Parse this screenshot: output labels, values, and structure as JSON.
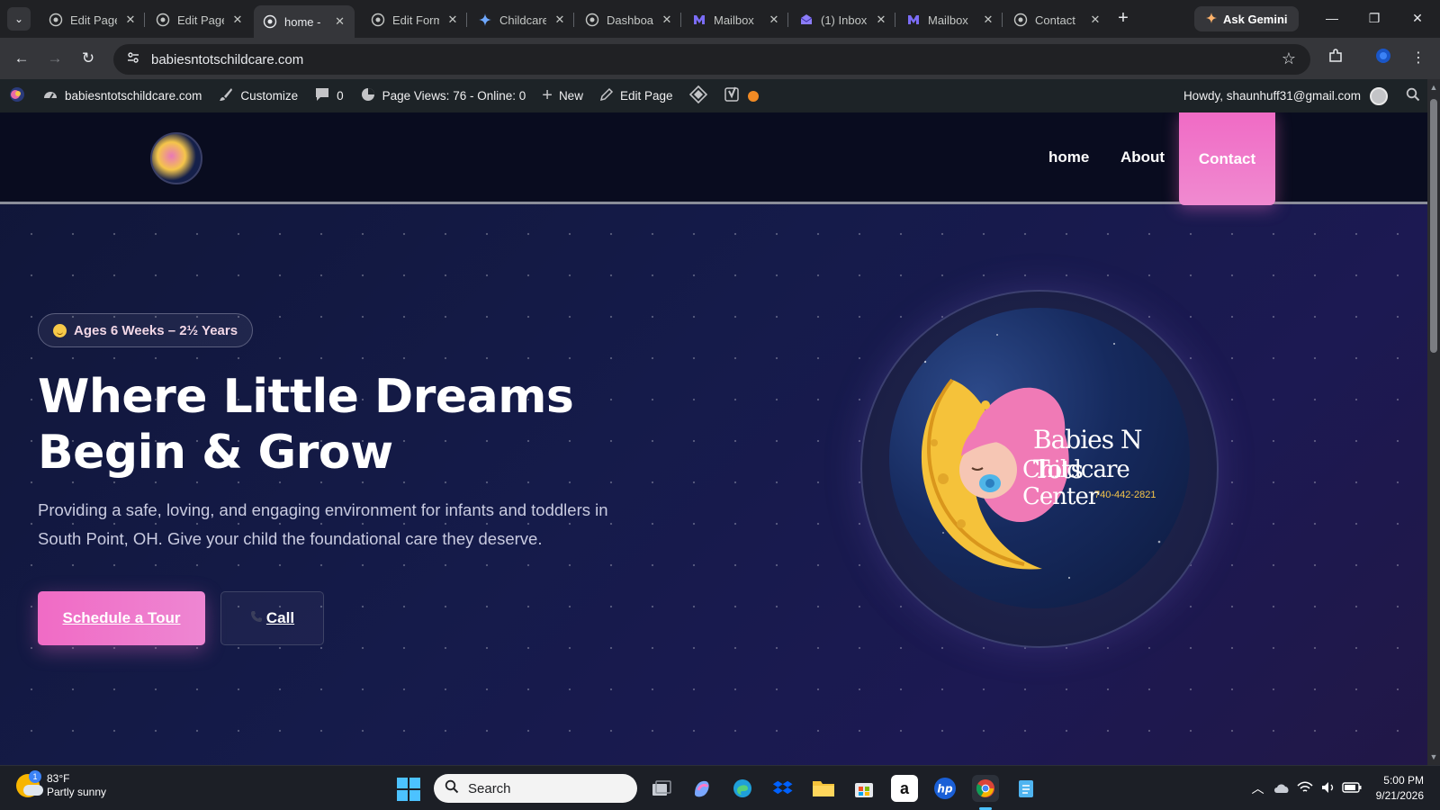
{
  "browser": {
    "tabs": [
      {
        "label": "Edit Page",
        "icon": "globe-icon",
        "active": false
      },
      {
        "label": "Edit Page",
        "icon": "globe-icon",
        "active": false
      },
      {
        "label": "home -",
        "icon": "globe-icon",
        "active": true
      },
      {
        "label": "Edit Form",
        "icon": "globe-icon",
        "active": false
      },
      {
        "label": "Childcare",
        "icon": "gemini-icon",
        "active": false
      },
      {
        "label": "Dashboard",
        "icon": "globe-icon",
        "active": false
      },
      {
        "label": "Mailbox",
        "icon": "mailbox-icon",
        "active": false
      },
      {
        "label": "(1) Inbox",
        "icon": "mail-icon",
        "active": false
      },
      {
        "label": "Mailbox",
        "icon": "mailbox-icon",
        "active": false
      },
      {
        "label": "Contact",
        "icon": "globe-icon",
        "active": false
      }
    ],
    "ask_gemini": "Ask Gemini",
    "url": "babiesntotschildcare.com"
  },
  "adminbar": {
    "site": "babiesntotschildcare.com",
    "customize": "Customize",
    "comments": "0",
    "page_views": "Page Views: 76 - Online: 0",
    "new": "New",
    "edit_page": "Edit Page",
    "howdy": "Howdy, shaunhuff31@gmail.com"
  },
  "site": {
    "nav": {
      "home": "home",
      "about": "About",
      "contact": "Contact"
    },
    "badge": "Ages 6 Weeks – 2½ Years",
    "title_line1": "Where Little Dreams",
    "title_line2": "Begin & Grow",
    "text": "Providing a safe, loving, and engaging environment for infants and toddlers in South Point, OH. Give your child the foundational care they deserve.",
    "btn_tour": "Schedule a Tour",
    "btn_call": "Call",
    "logo_line1": "Babies N Tots",
    "logo_line2": "Childcare Center",
    "logo_phone": "740-442-2821"
  },
  "taskbar": {
    "temp": "83°F",
    "weather": "Partly sunny",
    "weather_badge": "1",
    "search": "Search",
    "time": "5:00 PM",
    "date": "9/21/2026"
  },
  "colors": {
    "accent_pink": "#f06bc5",
    "page_bg": "#151b4a",
    "nav_bg": "#090c1f",
    "adminbar_bg": "#1d2327"
  }
}
